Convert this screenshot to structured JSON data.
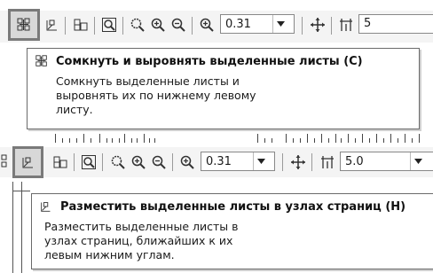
{
  "toolbar_top": {
    "zoom_value": "0.31",
    "step_value": "5"
  },
  "tooltip_top": {
    "title": "Сомкнуть и выровнять выделенные листы (С)",
    "body_lines": [
      "Сомкнуть выделенные листы и",
      "выровнять их по нижнему левому",
      "листу."
    ]
  },
  "toolbar_bottom": {
    "zoom_value": "0.31",
    "step_value": "5.0"
  },
  "tooltip_bottom": {
    "title": "Разместить выделенные листы в узлах страниц (Н)",
    "body_lines": [
      "Разместить выделенные листы в",
      "узлах страниц, ближайших к их",
      "левым нижним углам."
    ]
  }
}
